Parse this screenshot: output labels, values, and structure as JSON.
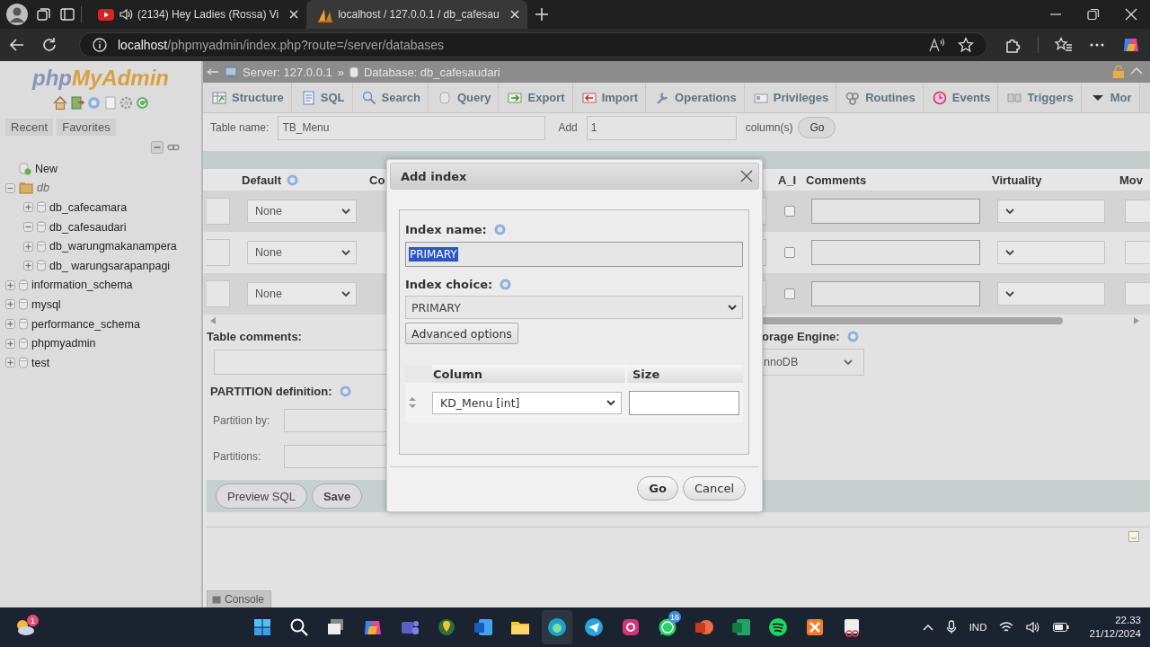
{
  "browser": {
    "tabs": [
      {
        "title": "(2134) Hey Ladies (Rossa) Vi",
        "kind": "video",
        "audio": true,
        "selected": false
      },
      {
        "title": "localhost / 127.0.0.1 / db_cafesau",
        "kind": "pma",
        "audio": false,
        "selected": true
      }
    ],
    "url_host": "localhost",
    "url_path": "/phpmyadmin/index.php?route=/server/databases"
  },
  "sidebar": {
    "logo_a": "php",
    "logo_b": "MyAdmin",
    "tabs": [
      {
        "label": "Recent"
      },
      {
        "label": "Favorites"
      }
    ],
    "tree": [
      {
        "label": "New",
        "kind": "new"
      },
      {
        "label": "db",
        "kind": "group",
        "expanded": true,
        "children": [
          {
            "label": "db_cafecamara",
            "kind": "database",
            "expanded": false
          },
          {
            "label": "db_cafesaudari",
            "kind": "database",
            "expanded": true
          },
          {
            "label": "db_warungmakanampera",
            "kind": "database",
            "expanded": false
          },
          {
            "label": "db_ warungsarapanpagi",
            "kind": "database",
            "expanded": false
          }
        ]
      },
      {
        "label": "information_schema",
        "kind": "database",
        "expanded": false
      },
      {
        "label": "mysql",
        "kind": "database",
        "expanded": false
      },
      {
        "label": "performance_schema",
        "kind": "database",
        "expanded": false
      },
      {
        "label": "phpmyadmin",
        "kind": "database",
        "expanded": false
      },
      {
        "label": "test",
        "kind": "database",
        "expanded": false
      }
    ]
  },
  "breadcrumb": {
    "server": "Server: 127.0.0.1",
    "separator": "»",
    "database": "Database: db_cafesaudari"
  },
  "menu_tabs": [
    {
      "label": "Structure",
      "kind": "structure"
    },
    {
      "label": "SQL",
      "kind": "sql"
    },
    {
      "label": "Search",
      "kind": "search"
    },
    {
      "label": "Query",
      "kind": "query"
    },
    {
      "label": "Export",
      "kind": "export"
    },
    {
      "label": "Import",
      "kind": "import"
    },
    {
      "label": "Operations",
      "kind": "operations"
    },
    {
      "label": "Privileges",
      "kind": "privileges"
    },
    {
      "label": "Routines",
      "kind": "routines"
    },
    {
      "label": "Events",
      "kind": "events"
    },
    {
      "label": "Triggers",
      "kind": "triggers"
    },
    {
      "label": "Mor",
      "kind": "more"
    }
  ],
  "table_form": {
    "name_label": "Table name:",
    "name_value": "TB_Menu",
    "add_label": "Add",
    "add_value": "1",
    "columns_label": "column(s)",
    "go": "Go"
  },
  "columns_left": [
    {
      "label": "Default",
      "help": true
    },
    {
      "label": "Co",
      "help": false
    }
  ],
  "columns_right": [
    {
      "label": "A_I"
    },
    {
      "label": "Comments"
    },
    {
      "label": "Virtuality"
    },
    {
      "label": "Mov"
    }
  ],
  "rows": [
    {
      "default": "None",
      "ai": false
    },
    {
      "default": "None",
      "ai": false
    },
    {
      "default": "None",
      "ai": false
    }
  ],
  "table_comments_label": "Table comments:",
  "storage_label": "orage Engine:",
  "storage_value": "nnoDB",
  "partition_label": "PARTITION definition:",
  "partition_by_label": "Partition by:",
  "partitions_label": "Partitions:",
  "buttons": [
    "Preview SQL",
    "Save"
  ],
  "console": "Console",
  "dialog": {
    "title": "Add index",
    "index_name_label": "Index name:",
    "index_name": "PRIMARY",
    "index_name_selected": true,
    "index_choice_label": "Index choice:",
    "index_choice": "PRIMARY",
    "advanced": "Advanced options",
    "column_header": "Column",
    "size_header": "Size",
    "columns": [
      {
        "column": "KD_Menu [int]"
      }
    ],
    "buttons": [
      {
        "label": "Go",
        "kind": "primary"
      },
      {
        "label": "Cancel",
        "kind": "secondary"
      }
    ]
  },
  "taskbar": {
    "weather_badge": "1",
    "apps": [
      {
        "kind": "start",
        "selected": false
      },
      {
        "kind": "search",
        "selected": false
      },
      {
        "kind": "taskview",
        "selected": false
      },
      {
        "kind": "copilot",
        "selected": false
      },
      {
        "kind": "teams",
        "selected": false
      },
      {
        "kind": "maps",
        "selected": false
      },
      {
        "kind": "word",
        "selected": false
      },
      {
        "kind": "explorer",
        "selected": false
      },
      {
        "kind": "edge",
        "selected": true
      },
      {
        "kind": "telegram",
        "selected": false
      },
      {
        "kind": "instagram",
        "selected": false
      },
      {
        "kind": "whatsapp",
        "selected": false,
        "badge": "16"
      },
      {
        "kind": "powerpoint",
        "selected": false
      },
      {
        "kind": "excel",
        "selected": false
      },
      {
        "kind": "spotify",
        "selected": false
      },
      {
        "kind": "xampp",
        "selected": false
      },
      {
        "kind": "snipping",
        "selected": false
      }
    ],
    "language": "IND",
    "time": "22.33",
    "date": "21/12/2024"
  }
}
